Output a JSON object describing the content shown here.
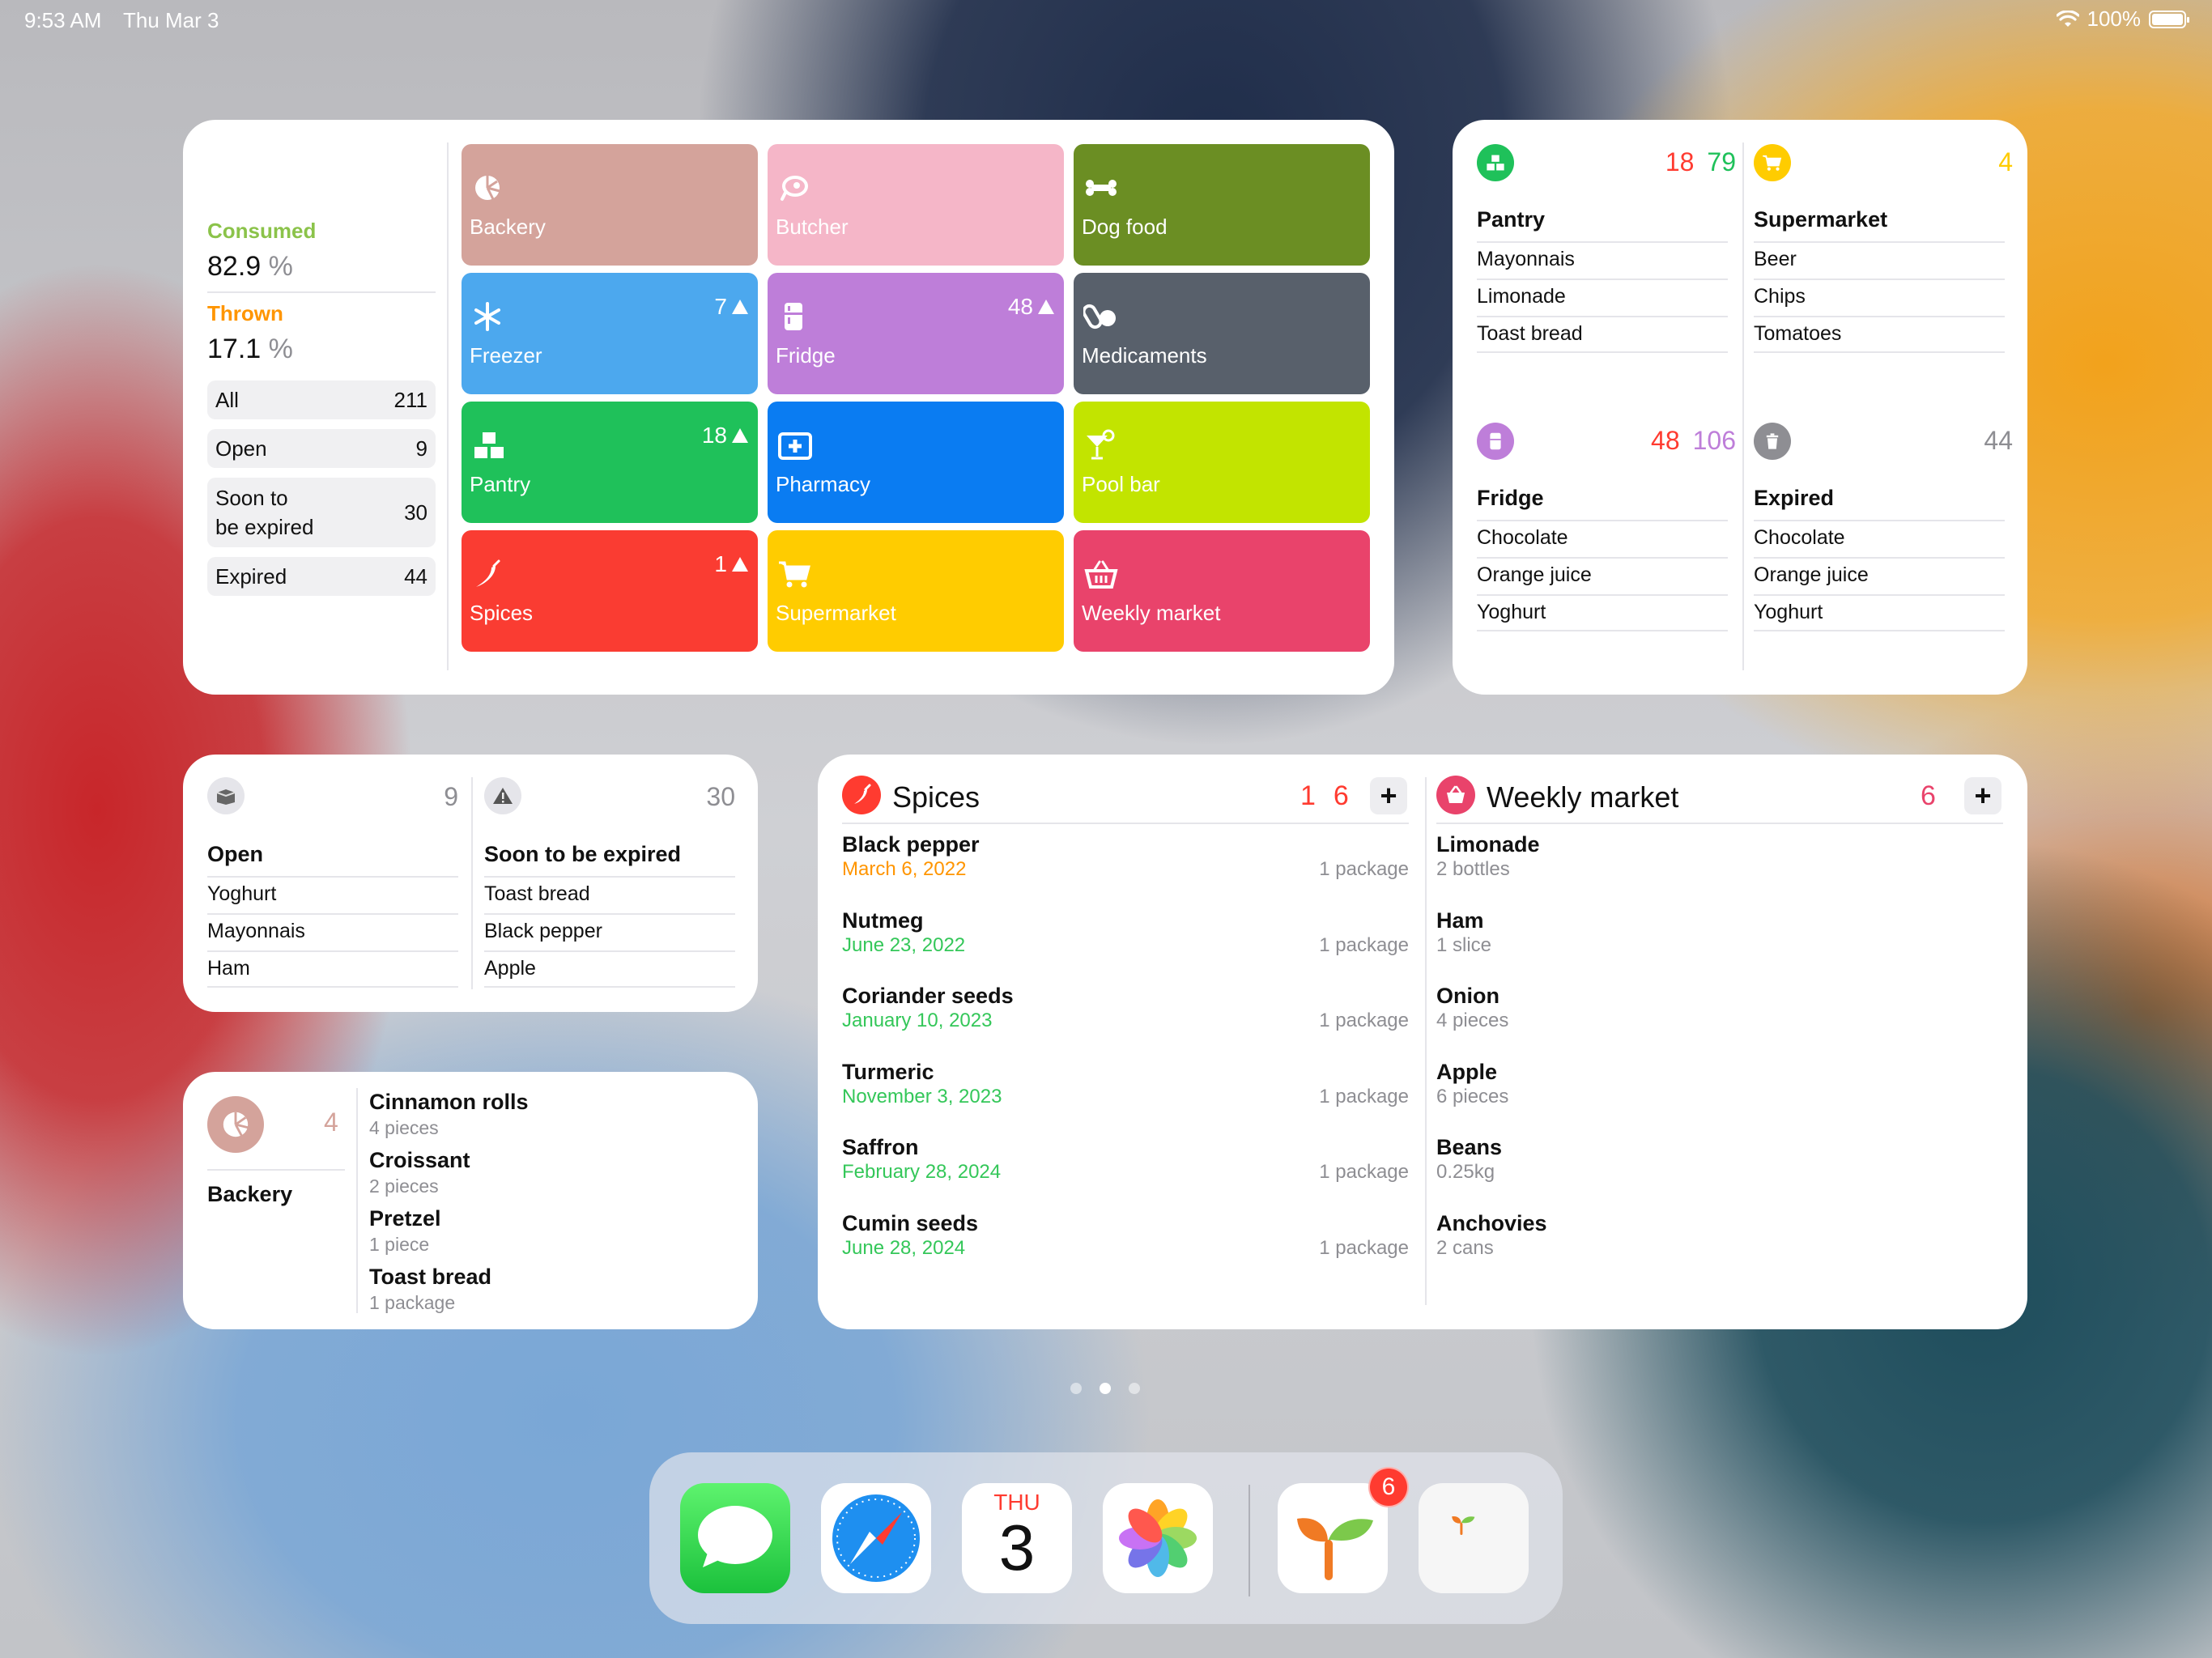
{
  "status_bar": {
    "time": "9:53 AM",
    "date": "Thu Mar 3",
    "battery": "100%"
  },
  "overview": {
    "consumed_label": "Consumed",
    "consumed_value": "82.9",
    "thrown_label": "Thrown",
    "thrown_value": "17.1",
    "percent_sign": "%",
    "rows": [
      {
        "label": "All",
        "count": "211"
      },
      {
        "label": "Open",
        "count": "9"
      },
      {
        "label": "Soon to be expired",
        "line1": "Soon to",
        "line2": "be expired",
        "count": "30"
      },
      {
        "label": "Expired",
        "count": "44"
      }
    ],
    "tiles": [
      {
        "name": "Backery",
        "icon": "croissant-icon",
        "color": "#d4a39b",
        "count": ""
      },
      {
        "name": "Butcher",
        "icon": "meat-icon",
        "color": "#f5b6c8",
        "count": ""
      },
      {
        "name": "Dog food",
        "icon": "bone-icon",
        "color": "#6b8e23",
        "count": ""
      },
      {
        "name": "Freezer",
        "icon": "snowflake-icon",
        "color": "#4ca8ee",
        "count": "7"
      },
      {
        "name": "Fridge",
        "icon": "fridge-icon",
        "color": "#be7ed9",
        "count": "48"
      },
      {
        "name": "Medicaments",
        "icon": "pills-icon",
        "color": "#58606b",
        "count": ""
      },
      {
        "name": "Pantry",
        "icon": "boxes-icon",
        "color": "#1fc15a",
        "count": "18"
      },
      {
        "name": "Pharmacy",
        "icon": "medkit-icon",
        "color": "#0a7cf2",
        "count": ""
      },
      {
        "name": "Pool bar",
        "icon": "cocktail-icon",
        "color": "#c2e400",
        "count": ""
      },
      {
        "name": "Spices",
        "icon": "chili-icon",
        "color": "#fa3c32",
        "count": "1"
      },
      {
        "name": "Supermarket",
        "icon": "cart-icon",
        "color": "#ffcc00",
        "count": ""
      },
      {
        "name": "Weekly market",
        "icon": "basket-icon",
        "color": "#e9436b",
        "count": ""
      }
    ]
  },
  "groups": [
    {
      "name": "Pantry",
      "icon": "boxes-icon",
      "color": "#1fc15a",
      "count_a": "18",
      "count_a_color": "#ff3b30",
      "count_b": "79",
      "count_b_color": "#1fc15a",
      "items": [
        "Mayonnais",
        "Limonade",
        "Toast bread"
      ]
    },
    {
      "name": "Supermarket",
      "icon": "cart-icon",
      "color": "#ffcc00",
      "count_a": "",
      "count_a_color": "#ff3b30",
      "count_b": "4",
      "count_b_color": "#ffcc00",
      "items": [
        "Beer",
        "Chips",
        "Tomatoes"
      ]
    },
    {
      "name": "Fridge",
      "icon": "fridge-icon",
      "color": "#be7ed9",
      "count_a": "48",
      "count_a_color": "#ff3b30",
      "count_b": "106",
      "count_b_color": "#be7ed9",
      "items": [
        "Chocolate",
        "Orange juice",
        "Yoghurt"
      ]
    },
    {
      "name": "Expired",
      "icon": "trash-icon",
      "color": "#8e8e93",
      "count_a": "",
      "count_a_color": "#ff3b30",
      "count_b": "44",
      "count_b_color": "#8e8e93",
      "items": [
        "Chocolate",
        "Orange juice",
        "Yoghurt"
      ]
    }
  ],
  "status_widget": [
    {
      "name": "Open",
      "icon": "open-box-icon",
      "count": "9",
      "items": [
        "Yoghurt",
        "Mayonnais",
        "Ham"
      ]
    },
    {
      "name": "Soon to be expired",
      "icon": "warning-icon",
      "count": "30",
      "items": [
        "Toast bread",
        "Black pepper",
        "Apple"
      ]
    }
  ],
  "backery_widget": {
    "name": "Backery",
    "count": "4",
    "items": [
      {
        "name": "Cinnamon rolls",
        "qty": "4 pieces"
      },
      {
        "name": "Croissant",
        "qty": "2 pieces"
      },
      {
        "name": "Pretzel",
        "qty": "1 piece"
      },
      {
        "name": "Toast bread",
        "qty": "1 package"
      }
    ]
  },
  "spices_list": {
    "title": "Spices",
    "count_a": "1",
    "count_b": "6",
    "items": [
      {
        "name": "Black pepper",
        "date": "March 6, 2022",
        "date_color": "#ff9500",
        "qty": "1 package"
      },
      {
        "name": "Nutmeg",
        "date": "June 23, 2022",
        "date_color": "#34c759",
        "qty": "1 package"
      },
      {
        "name": "Coriander seeds",
        "date": "January 10, 2023",
        "date_color": "#34c759",
        "qty": "1 package"
      },
      {
        "name": "Turmeric",
        "date": "November 3, 2023",
        "date_color": "#34c759",
        "qty": "1 package"
      },
      {
        "name": "Saffron",
        "date": "February 28, 2024",
        "date_color": "#34c759",
        "qty": "1 package"
      },
      {
        "name": "Cumin seeds",
        "date": "June 28, 2024",
        "date_color": "#34c759",
        "qty": "1 package"
      }
    ]
  },
  "market_list": {
    "title": "Weekly market",
    "count": "6",
    "items": [
      {
        "name": "Limonade",
        "qty": "2 bottles"
      },
      {
        "name": "Ham",
        "qty": "1 slice"
      },
      {
        "name": "Onion",
        "qty": "4 pieces"
      },
      {
        "name": "Apple",
        "qty": "6 pieces"
      },
      {
        "name": "Beans",
        "qty": "0.25kg"
      },
      {
        "name": "Anchovies",
        "qty": "2 cans"
      }
    ]
  },
  "plus_label": "+",
  "dock": {
    "calendar_day": "THU",
    "calendar_date": "3",
    "badge": "6",
    "apps": [
      "Messages",
      "Safari",
      "Calendar",
      "Photos",
      "Pantry app",
      "Pantry widget app"
    ]
  }
}
